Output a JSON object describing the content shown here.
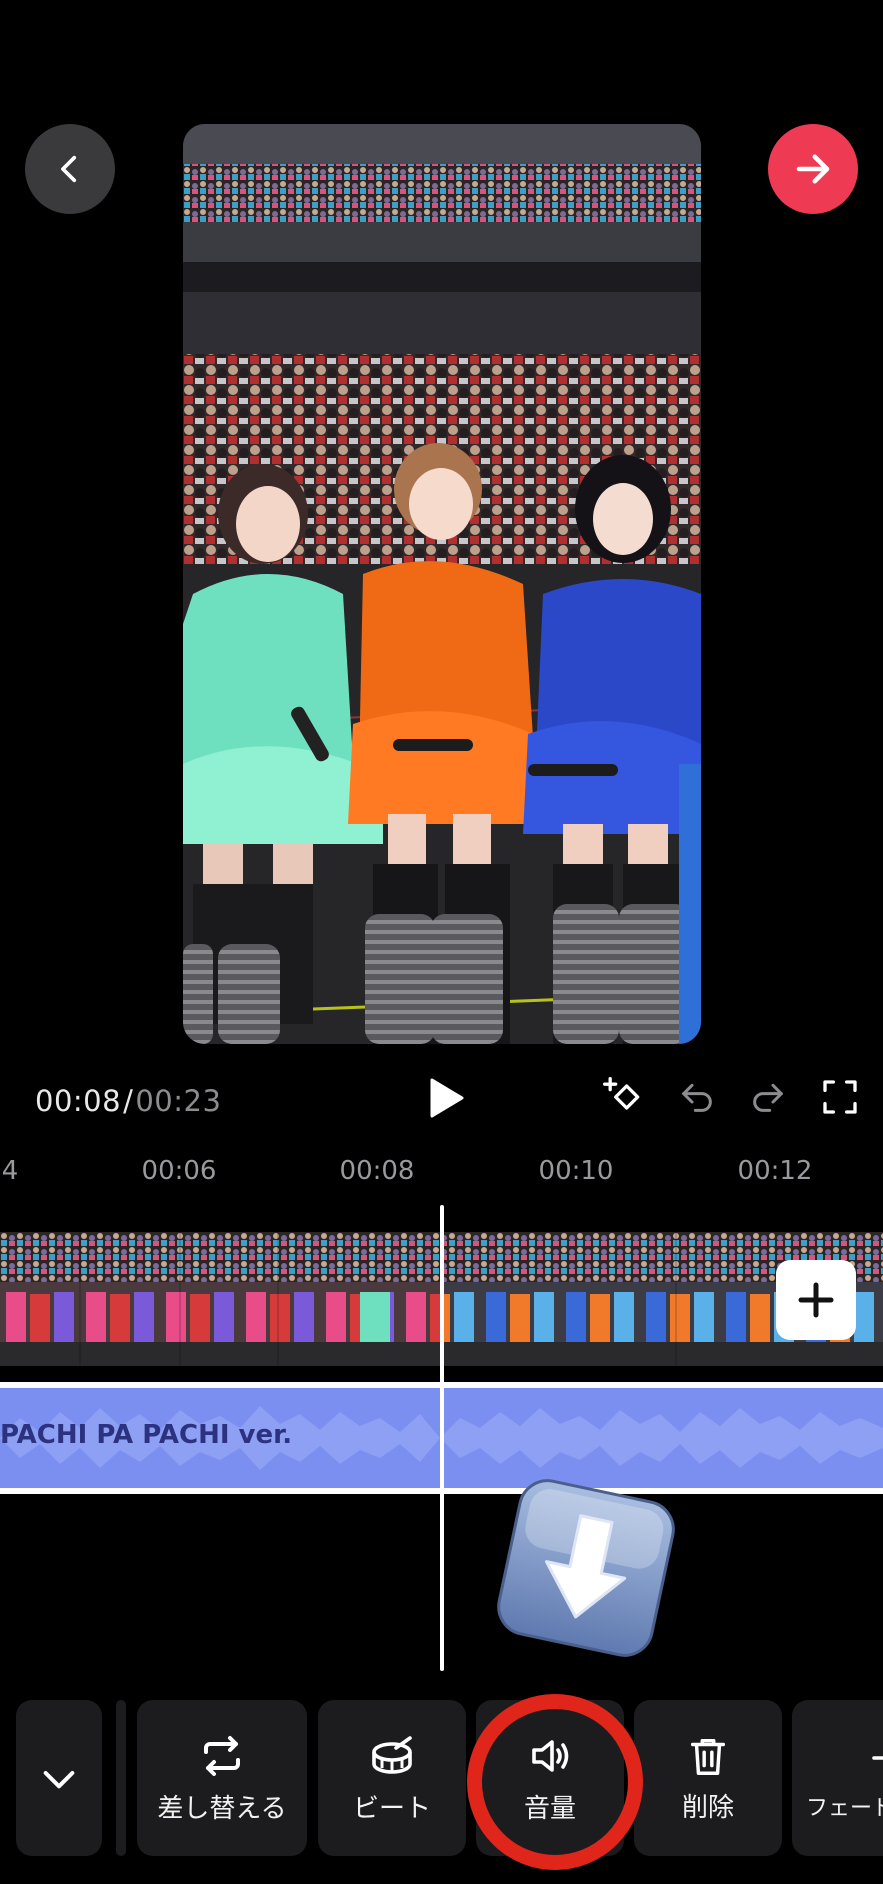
{
  "header": {
    "back_icon": "chevron-left-icon",
    "next_icon": "arrow-right-icon",
    "accent": "#ee3b53"
  },
  "playback": {
    "current_time": "00:08",
    "separator": "/",
    "total_time": "00:23"
  },
  "ruler": {
    "ticks": [
      "4",
      "00:06",
      "00:08",
      "00:10",
      "00:12"
    ]
  },
  "audio": {
    "title": "PACHI PA PACHI ver.",
    "color": "#7b8ff0"
  },
  "overlay": {
    "arrow_icon": "down-arrow-emoji-icon"
  },
  "toolbar": {
    "items": [
      {
        "label": "差し替える",
        "icon": "replace-icon"
      },
      {
        "label": "ビート",
        "icon": "drum-icon"
      },
      {
        "label": "音量",
        "icon": "speaker-icon"
      },
      {
        "label": "削除",
        "icon": "trash-icon"
      },
      {
        "label": "フェード",
        "icon": "fade-icon"
      }
    ]
  }
}
